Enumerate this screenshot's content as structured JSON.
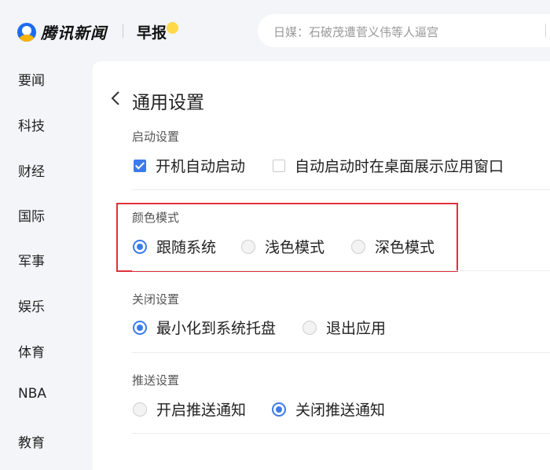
{
  "header": {
    "logo_text": "腾讯新闻",
    "zaobao_label": "早报",
    "search_placeholder": "日媒：石破茂遭菅义伟等人逼宫"
  },
  "sidebar": {
    "items": [
      {
        "label": "要闻"
      },
      {
        "label": "科技"
      },
      {
        "label": "财经"
      },
      {
        "label": "国际"
      },
      {
        "label": "军事"
      },
      {
        "label": "娱乐"
      },
      {
        "label": "体育"
      },
      {
        "label": "NBA"
      },
      {
        "label": "教育"
      }
    ]
  },
  "settings": {
    "title": "通用设置",
    "startup": {
      "label": "启动设置",
      "options": [
        {
          "label": "开机自动启动",
          "checked": true
        },
        {
          "label": "自动启动时在桌面展示应用窗口",
          "checked": false
        }
      ]
    },
    "color_mode": {
      "label": "颜色模式",
      "options": [
        {
          "label": "跟随系统",
          "selected": true
        },
        {
          "label": "浅色模式",
          "selected": false
        },
        {
          "label": "深色模式",
          "selected": false
        }
      ]
    },
    "close": {
      "label": "关闭设置",
      "options": [
        {
          "label": "最小化到系统托盘",
          "selected": true
        },
        {
          "label": "退出应用",
          "selected": false
        }
      ]
    },
    "push": {
      "label": "推送设置",
      "options": [
        {
          "label": "开启推送通知",
          "selected": false
        },
        {
          "label": "关闭推送通知",
          "selected": true
        }
      ]
    }
  },
  "colors": {
    "accent": "#3c7bea",
    "highlight_border": "#e0303c"
  }
}
